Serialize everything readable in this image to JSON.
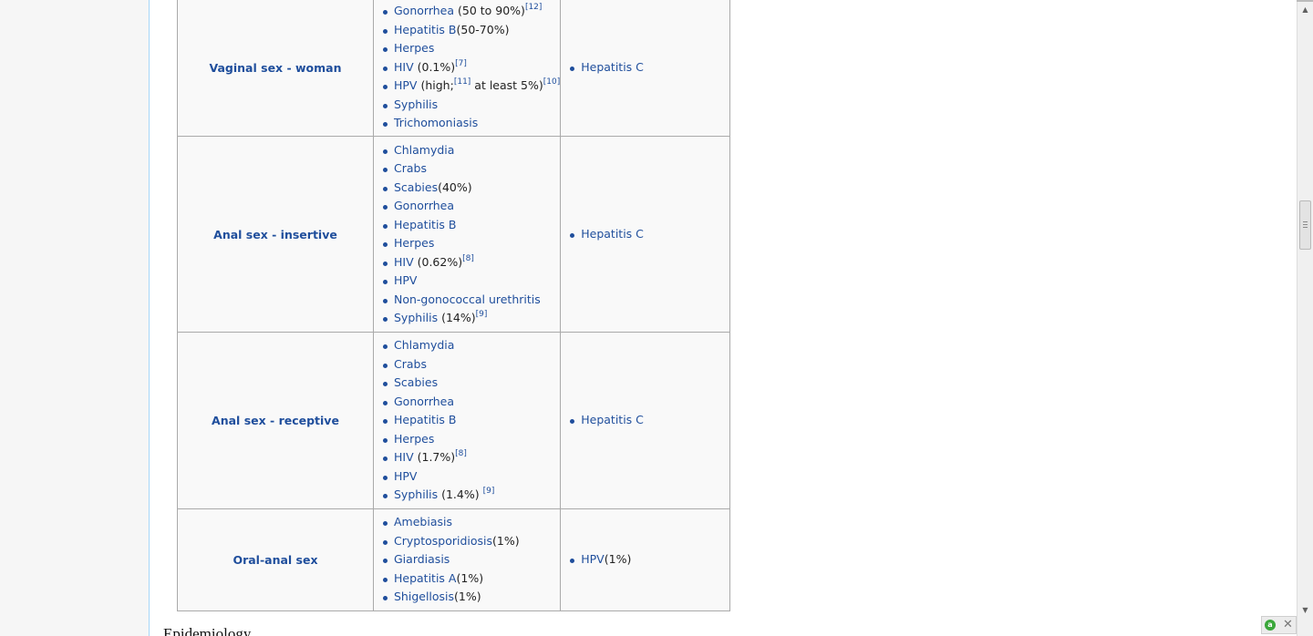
{
  "rows": [
    {
      "name": "Vaginal sex - woman",
      "high_risk": [
        {
          "name": "Gonorrhea",
          "extra": " (50 to 90%)",
          "ref": "[12]"
        },
        {
          "name": "Hepatitis B",
          "extra": "(50-70%)",
          "ref": ""
        },
        {
          "name": "Herpes",
          "extra": "",
          "ref": ""
        },
        {
          "name": "HIV",
          "extra": " (0.1%)",
          "ref": "[7]"
        },
        {
          "name": "HPV",
          "extra": " (high;",
          "ref": "[11]",
          "extra2": " at least 5%)",
          "ref2": "[10]"
        },
        {
          "name": "Syphilis",
          "extra": "",
          "ref": ""
        },
        {
          "name": "Trichomoniasis",
          "extra": "",
          "ref": ""
        }
      ],
      "low_risk": [
        {
          "name": "Hepatitis C",
          "extra": ""
        }
      ]
    },
    {
      "name": "Anal sex - insertive",
      "high_risk": [
        {
          "name": "Chlamydia",
          "extra": "",
          "ref": ""
        },
        {
          "name": "Crabs",
          "extra": "",
          "ref": ""
        },
        {
          "name": "Scabies",
          "extra": "(40%)",
          "ref": ""
        },
        {
          "name": "Gonorrhea",
          "extra": "",
          "ref": ""
        },
        {
          "name": "Hepatitis B",
          "extra": "",
          "ref": ""
        },
        {
          "name": "Herpes",
          "extra": "",
          "ref": ""
        },
        {
          "name": "HIV",
          "extra": " (0.62%)",
          "ref": "[8]"
        },
        {
          "name": "HPV",
          "extra": "",
          "ref": ""
        },
        {
          "name": "Non-gonococcal urethritis",
          "extra": "",
          "ref": ""
        },
        {
          "name": "Syphilis",
          "extra": " (14%)",
          "ref": "[9]"
        }
      ],
      "low_risk": [
        {
          "name": "Hepatitis C",
          "extra": ""
        }
      ]
    },
    {
      "name": "Anal sex - receptive",
      "high_risk": [
        {
          "name": "Chlamydia",
          "extra": "",
          "ref": ""
        },
        {
          "name": "Crabs",
          "extra": "",
          "ref": ""
        },
        {
          "name": "Scabies",
          "extra": "",
          "ref": ""
        },
        {
          "name": "Gonorrhea",
          "extra": "",
          "ref": ""
        },
        {
          "name": "Hepatitis B",
          "extra": "",
          "ref": ""
        },
        {
          "name": "Herpes",
          "extra": "",
          "ref": ""
        },
        {
          "name": "HIV",
          "extra": " (1.7%)",
          "ref": "[8]"
        },
        {
          "name": "HPV",
          "extra": "",
          "ref": ""
        },
        {
          "name": "Syphilis",
          "extra": " (1.4%) ",
          "ref": "[9]"
        }
      ],
      "low_risk": [
        {
          "name": "Hepatitis C",
          "extra": ""
        }
      ]
    },
    {
      "name": "Oral-anal sex",
      "high_risk": [
        {
          "name": "Amebiasis",
          "extra": "",
          "ref": ""
        },
        {
          "name": "Cryptosporidiosis",
          "extra": "(1%)",
          "ref": ""
        },
        {
          "name": "Giardiasis",
          "extra": "",
          "ref": ""
        },
        {
          "name": "Hepatitis A",
          "extra": "(1%)",
          "ref": ""
        },
        {
          "name": "Shigellosis",
          "extra": "(1%)",
          "ref": ""
        }
      ],
      "low_risk": [
        {
          "name": "HPV",
          "extra": "(1%)"
        }
      ]
    }
  ],
  "next_heading": "Epidemiology"
}
